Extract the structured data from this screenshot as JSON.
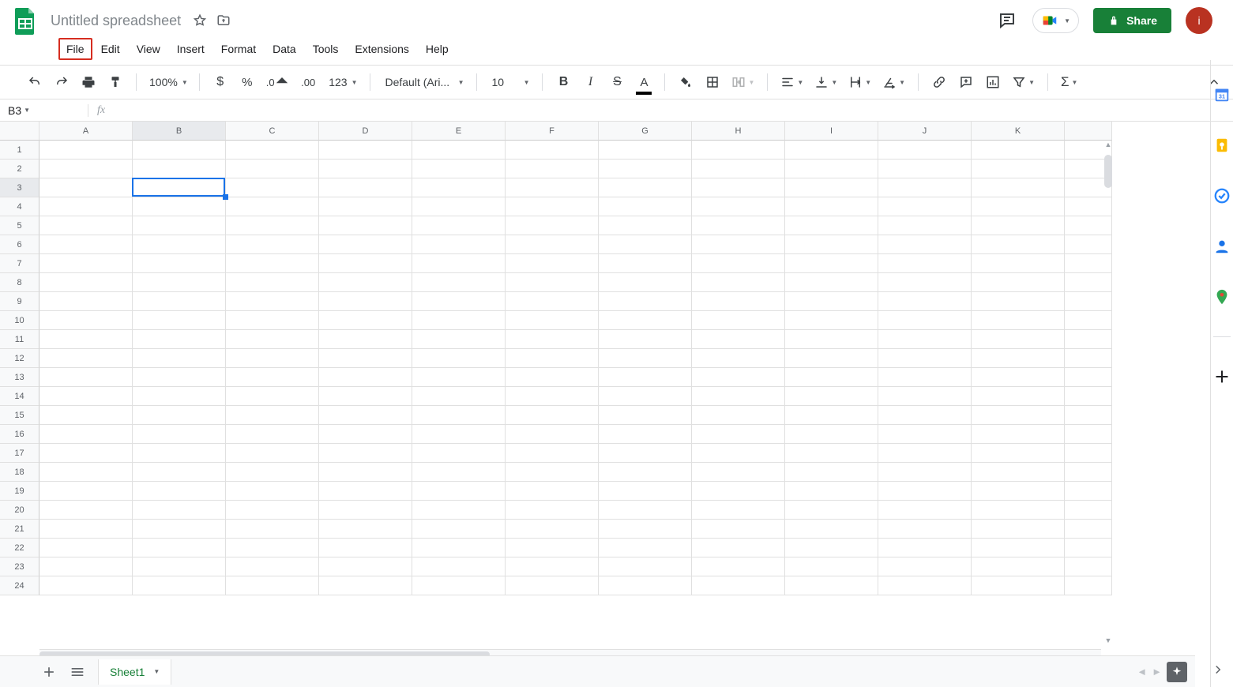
{
  "header": {
    "doc_title": "Untitled spreadsheet",
    "share_label": "Share",
    "avatar_initial": "i"
  },
  "menus": [
    "File",
    "Edit",
    "View",
    "Insert",
    "Format",
    "Data",
    "Tools",
    "Extensions",
    "Help"
  ],
  "highlighted_menu_index": 0,
  "toolbar": {
    "zoom": "100%",
    "font": "Default (Ari...",
    "font_size": "10",
    "number_format_label": "123"
  },
  "name_box": "B3",
  "formula": "",
  "grid": {
    "columns": [
      "A",
      "B",
      "C",
      "D",
      "E",
      "F",
      "G",
      "H",
      "I",
      "J",
      "K"
    ],
    "rows": [
      1,
      2,
      3,
      4,
      5,
      6,
      7,
      8,
      9,
      10,
      11,
      12,
      13,
      14,
      15,
      16,
      17,
      18,
      19,
      20,
      21,
      22,
      23,
      24
    ],
    "selected_cell": {
      "col": "B",
      "row": 3,
      "col_index": 1,
      "row_index": 2
    }
  },
  "sheet_tabs": {
    "active": "Sheet1"
  },
  "side_panel": {
    "calendar_day": "31"
  }
}
